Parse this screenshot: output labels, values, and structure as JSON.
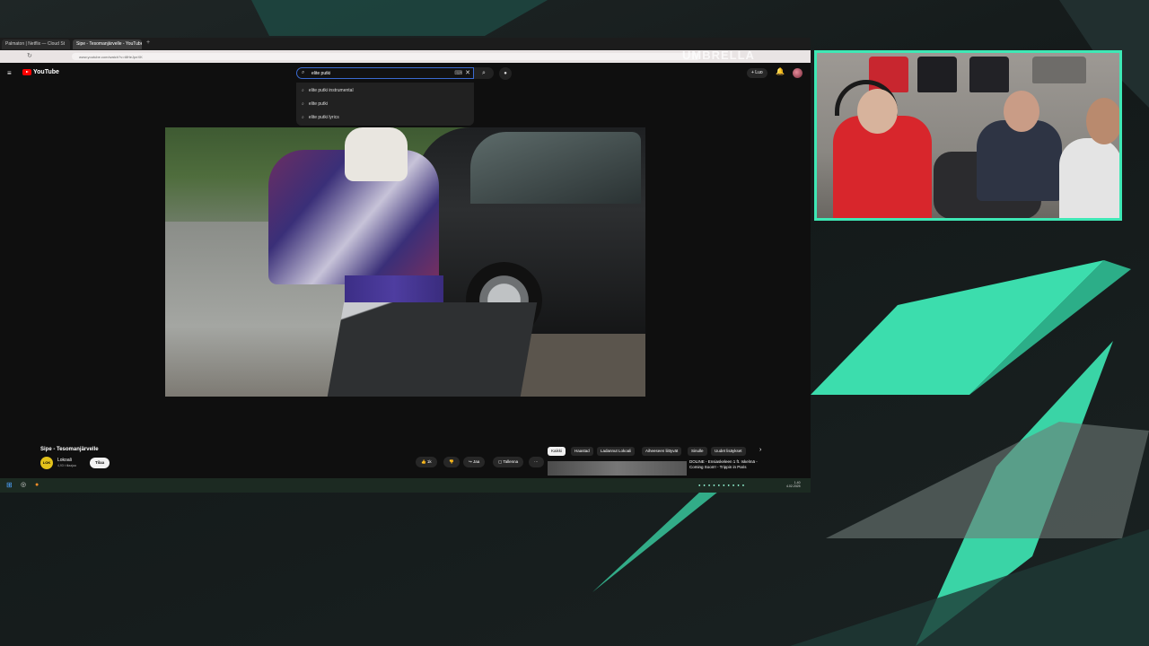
{
  "browser": {
    "tabs": [
      {
        "label": "Palmaton | Netflix — Cloud St"
      },
      {
        "label": "Sipe - Tesomanjärvelle - YouTube"
      }
    ],
    "new_tab": "+",
    "address": "www.youtube.com/watch?v=t8HeJpeXK",
    "overlay_brand": "UMBRELLA"
  },
  "youtube": {
    "logo": "YouTube",
    "search": {
      "query": "elite putki",
      "suggestions": [
        "elite putki instrumental",
        "elite putki",
        "elite putki lyrics"
      ]
    },
    "create_label": "+ Luo",
    "video": {
      "title": "Sipe - Tesomanjärvelle",
      "channel": "Lokoali",
      "channel_avatar_text": "LOK",
      "subscribers": "4,93 t tilaajaa",
      "subscribe_label": "Tilaa",
      "likes": "1k",
      "share_label": "Jaa",
      "save_label": "Tallenna",
      "more_label": "···"
    },
    "chips": [
      "Kaikki",
      "Haastad",
      "Ladannut Lokoali",
      "Aiheeseen liittyvät",
      "Sinulle",
      "Uudet lisäykset"
    ],
    "recommendation": {
      "title": "DOLINE - Ensiaskeleen 1 ft. Iskelmä - Coming Soon!! - Trippin in Paris"
    }
  },
  "taskbar": {
    "clock_time": "1.40",
    "clock_date": "4.02.2025"
  },
  "colors": {
    "accent": "#3ee8b5",
    "youtube_red": "#ff0000",
    "background": "#1a1f1f"
  }
}
